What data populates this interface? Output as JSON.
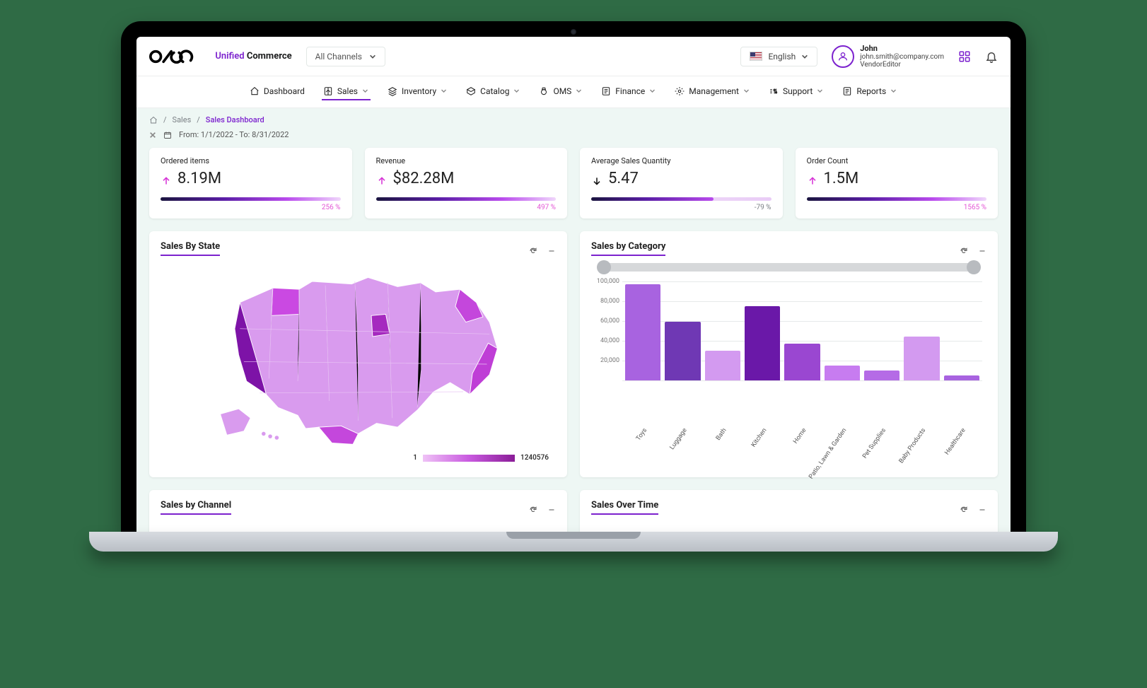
{
  "brand": {
    "unified": "Unified",
    "commerce": "Commerce"
  },
  "channel_selector": {
    "label": "All Channels"
  },
  "language": {
    "label": "English"
  },
  "user": {
    "name": "John",
    "email": "john.smith@company.com",
    "role": "VendorEditor"
  },
  "nav": [
    {
      "id": "dashboard",
      "label": "Dashboard",
      "dropdown": false
    },
    {
      "id": "sales",
      "label": "Sales",
      "dropdown": true,
      "active": true
    },
    {
      "id": "inventory",
      "label": "Inventory",
      "dropdown": true
    },
    {
      "id": "catalog",
      "label": "Catalog",
      "dropdown": true
    },
    {
      "id": "oms",
      "label": "OMS",
      "dropdown": true
    },
    {
      "id": "finance",
      "label": "Finance",
      "dropdown": true
    },
    {
      "id": "management",
      "label": "Management",
      "dropdown": true
    },
    {
      "id": "support",
      "label": "Support",
      "dropdown": true
    },
    {
      "id": "reports",
      "label": "Reports",
      "dropdown": true
    }
  ],
  "breadcrumbs": {
    "l1": "Sales",
    "l2": "Sales Dashboard"
  },
  "date_filter": {
    "from_prefix": "From:",
    "from": "1/1/2022",
    "to_prefix": "To:",
    "to": "8/31/2022"
  },
  "kpis": [
    {
      "label": "Ordered items",
      "value": "8.19M",
      "direction": "up",
      "pct": "256 %"
    },
    {
      "label": "Revenue",
      "value": "$82.28M",
      "direction": "up",
      "pct": "497 %"
    },
    {
      "label": "Average Sales Quantity",
      "value": "5.47",
      "direction": "down",
      "pct": "-79 %"
    },
    {
      "label": "Order Count",
      "value": "1.5M",
      "direction": "up",
      "pct": "1565 %"
    }
  ],
  "panels": {
    "state": {
      "title": "Sales By State",
      "legend_min": "1",
      "legend_max": "1240576"
    },
    "category": {
      "title": "Sales by Category"
    },
    "channel": {
      "title": "Sales by Channel"
    },
    "time": {
      "title": "Sales Over Time"
    }
  },
  "chart_data": {
    "type": "bar",
    "title": "Sales by Category",
    "ylabel": "",
    "ylim": [
      0,
      100000
    ],
    "yticks": [
      0,
      20000,
      40000,
      60000,
      80000,
      100000
    ],
    "ytick_labels": [
      "",
      "20,000",
      "40,000",
      "60,000",
      "80,000",
      "100,000"
    ],
    "categories": [
      "Toys",
      "Luggage",
      "Bath",
      "Kitchen",
      "Home",
      "Patio, Lawn & Garden",
      "Pet Supplies",
      "Baby Products",
      "Healthcare"
    ],
    "values": [
      97000,
      59000,
      30000,
      75000,
      37000,
      15000,
      10000,
      44000,
      5000
    ],
    "colors": [
      "#a863e0",
      "#6f38b4",
      "#d39af0",
      "#6a18a8",
      "#9a47d1",
      "#c77cf0",
      "#b56be6",
      "#d39af0",
      "#a863e0"
    ]
  }
}
